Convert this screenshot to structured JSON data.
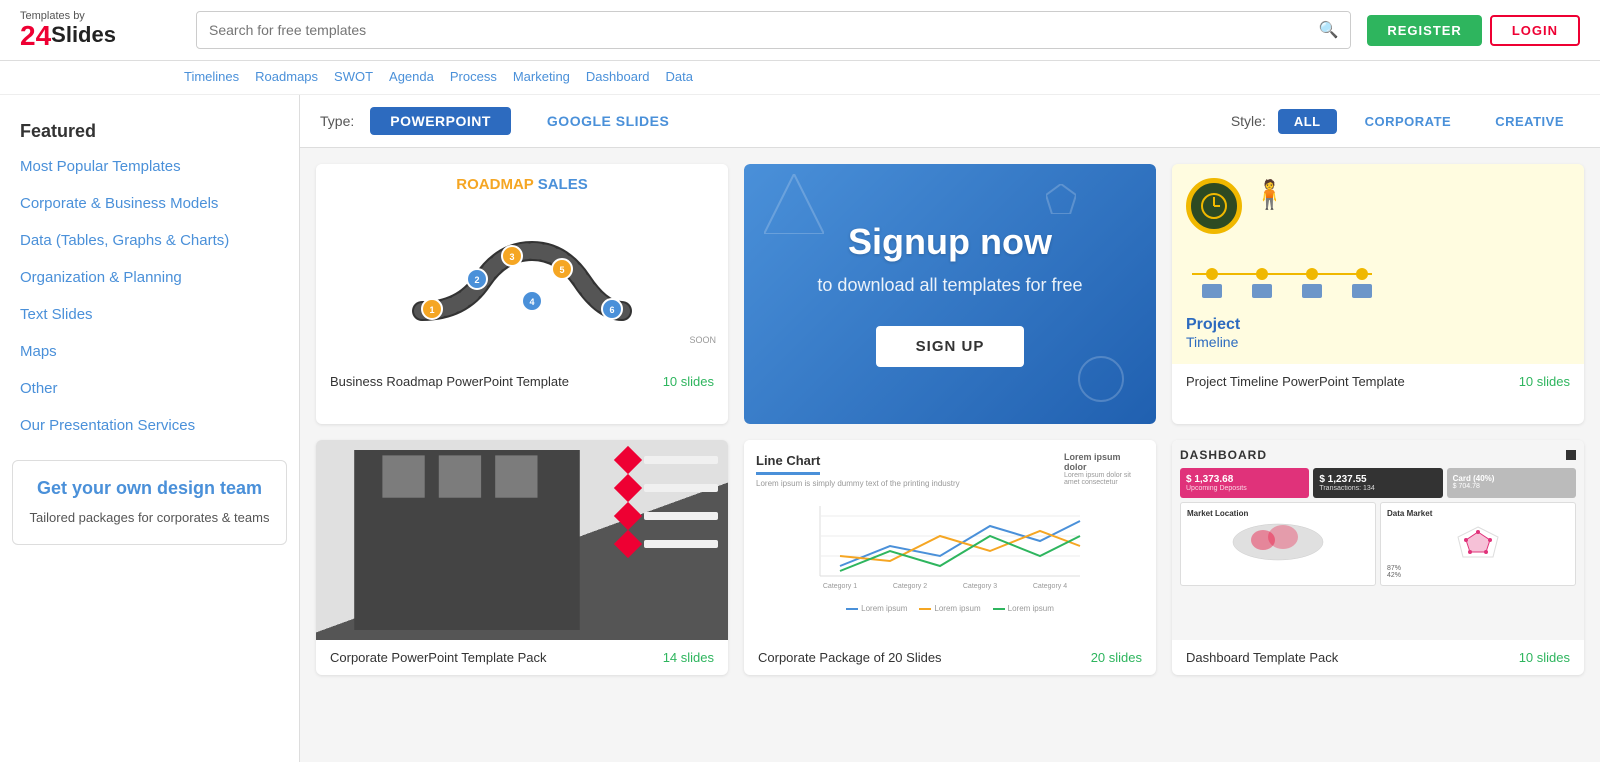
{
  "header": {
    "logo_toptext": "Templates by",
    "logo_brand": "24Slides",
    "search_placeholder": "Search for free templates",
    "register_label": "REGISTER",
    "login_label": "LOGIN"
  },
  "sub_nav": {
    "tags": [
      "Timelines",
      "Roadmaps",
      "SWOT",
      "Agenda",
      "Process",
      "Marketing",
      "Dashboard",
      "Data"
    ]
  },
  "filter_bar": {
    "type_label": "Type:",
    "types": [
      {
        "label": "POWERPOINT",
        "active": true
      },
      {
        "label": "GOOGLE SLIDES",
        "active": false
      }
    ],
    "style_label": "Style:",
    "styles": [
      {
        "label": "ALL",
        "active": true
      },
      {
        "label": "CORPORATE",
        "active": false
      },
      {
        "label": "CREATIVE",
        "active": false
      }
    ]
  },
  "sidebar": {
    "section_title": "Featured",
    "nav_items": [
      {
        "label": "Most Popular Templates",
        "active": false
      },
      {
        "label": "Corporate & Business Models",
        "active": false
      },
      {
        "label": "Data (Tables, Graphs & Charts)",
        "active": false
      },
      {
        "label": "Organization & Planning",
        "active": false
      },
      {
        "label": "Text Slides",
        "active": false
      },
      {
        "label": "Maps",
        "active": false
      },
      {
        "label": "Other",
        "active": false
      },
      {
        "label": "Our Presentation Services",
        "active": false
      }
    ],
    "promo": {
      "title": "Get your own design team",
      "subtitle": "Tailored packages for corporates & teams"
    }
  },
  "templates": [
    {
      "title": "Business Roadmap PowerPoint Template",
      "slides": "10 slides",
      "type": "roadmap"
    },
    {
      "title": "signup",
      "slides": "",
      "type": "signup"
    },
    {
      "title": "Project Timeline PowerPoint Template",
      "slides": "10 slides",
      "type": "timeline"
    },
    {
      "title": "Corporate PowerPoint Template Pack",
      "slides": "14 slides",
      "type": "corporate"
    },
    {
      "title": "Corporate Package of 20 Slides",
      "slides": "20 slides",
      "type": "linechart"
    },
    {
      "title": "Dashboard Template Pack",
      "slides": "10 slides",
      "type": "dashboard"
    }
  ],
  "signup_card": {
    "heading": "Signup now",
    "subtext": "to download all templates for free",
    "button_label": "SIGN UP"
  }
}
